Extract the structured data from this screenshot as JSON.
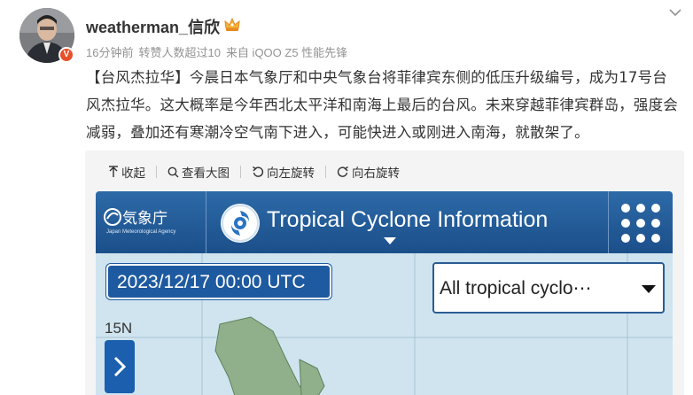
{
  "user": {
    "name": "weatherman_信欣",
    "verified_badge": "V",
    "accent": "#e8502a"
  },
  "meta": {
    "time": "16分钟前",
    "reposts": "转赞人数超过10",
    "source": "来自 iQOO Z5 性能先锋"
  },
  "post": {
    "text": "【台风杰拉华】今晨日本气象厅和中央气象台将菲律宾东侧的低压升级编号，成为17号台风杰拉华。这大概率是今年西北太平洋和南海上最后的台风。未来穿越菲律宾群岛，强度会减弱，叠加还有寒潮冷空气南下进入，可能快进入或刚进入南海，就散架了。"
  },
  "toolbar": {
    "collapse": "收起",
    "view_large": "查看大图",
    "rotate_left": "向左旋转",
    "rotate_right": "向右旋转"
  },
  "map": {
    "agency": "気象庁",
    "agency_sub": "Japan Meteorological Agency",
    "title": "Tropical Cyclone Information",
    "timestamp": "2023/12/17 00:00 UTC",
    "selector": "All tropical cyclo⋯",
    "lat_label": "15N",
    "colors": {
      "header": "#1b4f8a",
      "sea": "#cfe4ef",
      "land": "#8fb08a"
    }
  }
}
